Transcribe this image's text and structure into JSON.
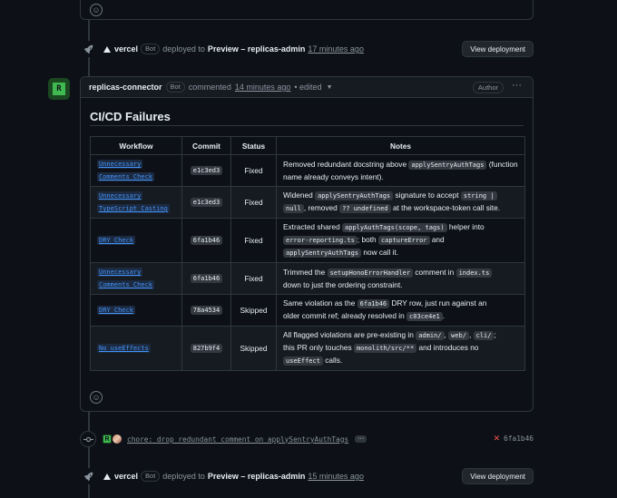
{
  "top_card": {
    "emoji_icon": "smiley-icon"
  },
  "deploy_events": [
    {
      "actor": "vercel",
      "bot_label": "Bot",
      "verb": "deployed to",
      "environment": "Preview – replicas-admin",
      "time": "17 minutes ago",
      "button_label": "View deployment"
    },
    {
      "actor": "vercel",
      "bot_label": "Bot",
      "verb": "deployed to",
      "environment": "Preview – replicas-admin",
      "time": "15 minutes ago",
      "button_label": "View deployment"
    }
  ],
  "comment": {
    "avatar_letter": "R",
    "author": "replicas-connector",
    "bot_label": "Bot",
    "verb": "commented",
    "time": "14 minutes ago",
    "edited": "• edited",
    "role": "Author",
    "menu_glyph": "···",
    "title": "CI/CD Failures",
    "table": {
      "headers": [
        "Workflow",
        "Commit",
        "Status",
        "Notes"
      ],
      "rows": [
        {
          "workflow": [
            "Unnecessary",
            "Comments Check"
          ],
          "commit": "e1c3ed3",
          "status": "Fixed",
          "notes": [
            {
              "t": "Removed redundant docstring above "
            },
            {
              "c": "applySentryAuthTags"
            },
            {
              "t": " (function name already conveys intent)."
            }
          ]
        },
        {
          "workflow": [
            "Unnecessary",
            "TypeScript Casting"
          ],
          "commit": "e1c3ed3",
          "status": "Fixed",
          "notes": [
            {
              "t": "Widened "
            },
            {
              "c": "applySentryAuthTags"
            },
            {
              "t": " signature to accept "
            },
            {
              "c": "string |"
            },
            {
              "br": true
            },
            {
              "c": "null"
            },
            {
              "t": ", removed "
            },
            {
              "c": "?? undefined"
            },
            {
              "t": " at the workspace-token call site."
            }
          ]
        },
        {
          "workflow": [
            "DRY Check"
          ],
          "commit": "6fa1b46",
          "status": "Fixed",
          "notes": [
            {
              "t": "Extracted shared "
            },
            {
              "c": "applyAuthTags(scope, tags)"
            },
            {
              "t": " helper into "
            },
            {
              "br": true
            },
            {
              "c": "error-reporting.ts"
            },
            {
              "t": "; both "
            },
            {
              "c": "captureError"
            },
            {
              "t": " and "
            },
            {
              "br": true
            },
            {
              "c": "applySentryAuthTags"
            },
            {
              "t": " now call it."
            }
          ]
        },
        {
          "workflow": [
            "Unnecessary",
            "Comments Check"
          ],
          "commit": "6fa1b46",
          "status": "Fixed",
          "notes": [
            {
              "t": "Trimmed the "
            },
            {
              "c": "setupHonoErrorHandler"
            },
            {
              "t": " comment in "
            },
            {
              "c": "index.ts"
            },
            {
              "br": true
            },
            {
              "t": "down to just the ordering constraint."
            }
          ]
        },
        {
          "workflow": [
            "DRY Check"
          ],
          "commit": "78a4534",
          "status": "Skipped",
          "notes": [
            {
              "t": "Same violation as the "
            },
            {
              "c": "6fa1b46"
            },
            {
              "t": " DRY row, just run against an"
            },
            {
              "br": true
            },
            {
              "t": "older commit ref; already resolved in "
            },
            {
              "c": "c03ce4e1"
            },
            {
              "t": "."
            }
          ]
        },
        {
          "workflow": [
            "No useEffects"
          ],
          "commit": "827b9f4",
          "status": "Skipped",
          "notes": [
            {
              "t": "All flagged violations are pre-existing in "
            },
            {
              "c": "admin/"
            },
            {
              "t": ", "
            },
            {
              "c": "web/"
            },
            {
              "t": ", "
            },
            {
              "c": "cli/"
            },
            {
              "t": ";"
            },
            {
              "br": true
            },
            {
              "t": "this PR only touches "
            },
            {
              "c": "monolith/src/**"
            },
            {
              "t": " and introduces no"
            },
            {
              "br": true
            },
            {
              "c": "useEffect"
            },
            {
              "t": " calls."
            }
          ]
        }
      ]
    }
  },
  "commit_event": {
    "avatar_letter": "R",
    "message": "chore: drop redundant comment on applySentryAuthTags",
    "expand_label": "···",
    "status_glyph": "✕",
    "sha": "6fa1b46",
    "status_color": "#f85149"
  }
}
